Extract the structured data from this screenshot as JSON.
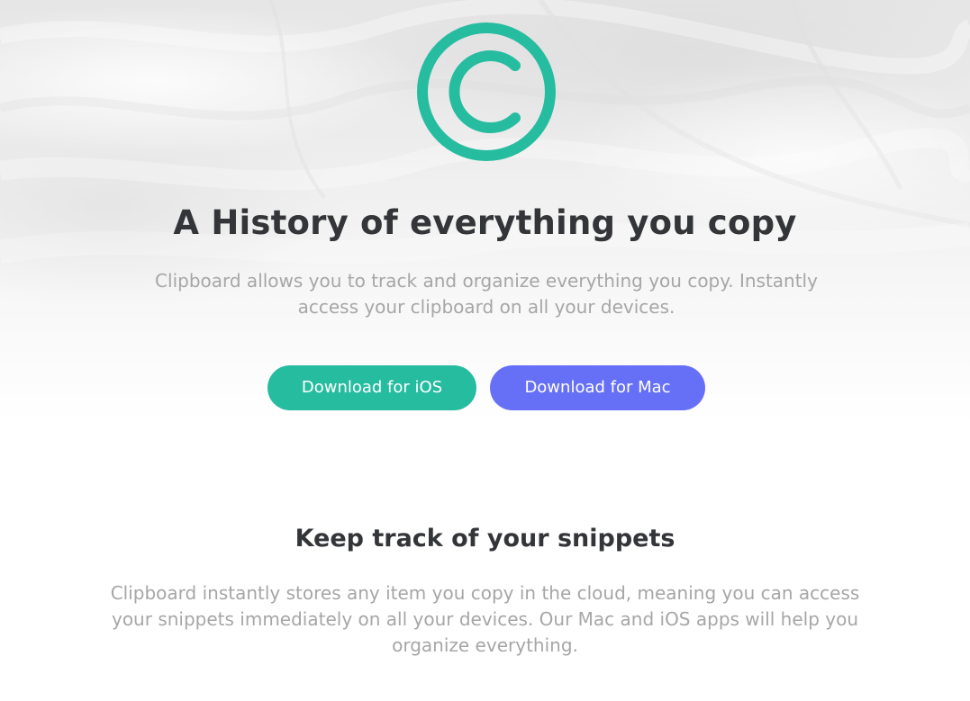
{
  "hero": {
    "logo_icon": "copyright-c-icon",
    "title": "A History of everything you copy",
    "subtitle": "Clipboard allows you to track and organize everything you copy. Instantly access your clipboard on all your devices.",
    "buttons": {
      "ios_label": "Download for iOS",
      "mac_label": "Download for Mac"
    }
  },
  "feature": {
    "title": "Keep track of your snippets",
    "body": "Clipboard instantly stores any item you copy in the cloud, meaning you can access your snippets immediately on all your devices. Our Mac and iOS apps will help you organize everything."
  },
  "colors": {
    "accent_teal": "#26bca0",
    "accent_purple": "#6670f6",
    "heading": "#333538",
    "body_text": "#a6a6a6"
  }
}
